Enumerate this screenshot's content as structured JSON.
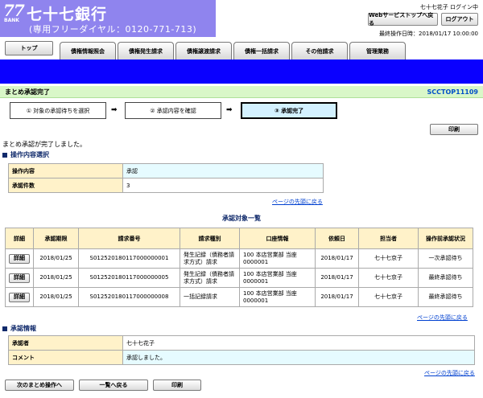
{
  "header": {
    "logo_number": "77",
    "logo_sub": "BANK",
    "bank_name": "七十七銀行",
    "phone": "(専用フリーダイヤル：0120-771-713)",
    "user_info": "七十七花子 ログイン中",
    "web_services_button": "Webサービストップへ戻る",
    "logout_button": "ログアウト",
    "last_operation": "最終操作日時：2018/01/17 10:00:00"
  },
  "nav": {
    "home": "トップ",
    "tabs": [
      "債権情報照会",
      "債権発生請求",
      "債権譲渡請求",
      "債権一括請求",
      "その他請求",
      "管理業務"
    ]
  },
  "title_bar": {
    "title": "まとめ承認完了",
    "screen_id": "SCCTOP11109"
  },
  "steps": [
    {
      "label": "① 対象の承認待ちを選択"
    },
    {
      "label": "② 承認内容を確認"
    },
    {
      "label": "③ 承認完了"
    }
  ],
  "step_arrow": "➡",
  "print_button": "印刷",
  "message": "まとめ承認が完了しました。",
  "operation": {
    "heading": "操作内容選択",
    "rows": [
      {
        "label": "操作内容",
        "value": "承認"
      },
      {
        "label": "承認件数",
        "value": "3"
      }
    ],
    "top_link": "ページの先頭に戻る"
  },
  "list": {
    "title": "承認対象一覧",
    "headers": [
      "詳細",
      "承認期限",
      "請求番号",
      "請求種別",
      "口座情報",
      "依頼日",
      "担当者",
      "操作前承認状況"
    ],
    "detail_label": "詳細",
    "rows": [
      {
        "deadline": "2018/01/25",
        "request_no": "S012520180117000000001",
        "type": "発生記録（債務者請求方式）請求",
        "account": "100 本店営業部 当座 0000001",
        "date": "2018/01/17",
        "person": "七十七京子",
        "status": "一次承認待ち"
      },
      {
        "deadline": "2018/01/25",
        "request_no": "S012520180117000000005",
        "type": "発生記録（債務者請求方式）請求",
        "account": "100 本店営業部 当座 0000001",
        "date": "2018/01/17",
        "person": "七十七京子",
        "status": "最終承認待ち"
      },
      {
        "deadline": "2018/01/25",
        "request_no": "S012520180117000000008",
        "type": "一括記録請求",
        "account": "100 本店営業部 当座 0000001",
        "date": "2018/01/17",
        "person": "七十七京子",
        "status": "最終承認待ち"
      }
    ],
    "top_link": "ページの先頭に戻る"
  },
  "approval": {
    "heading": "承認情報",
    "rows": [
      {
        "label": "承認者",
        "value": "七十七花子"
      },
      {
        "label": "コメント",
        "value": "承認しました。"
      }
    ],
    "top_link": "ページの先頭に戻る"
  },
  "footer": {
    "next_button": "次のまとめ操作へ",
    "back_button": "一覧へ戻る",
    "print_button": "印刷"
  }
}
